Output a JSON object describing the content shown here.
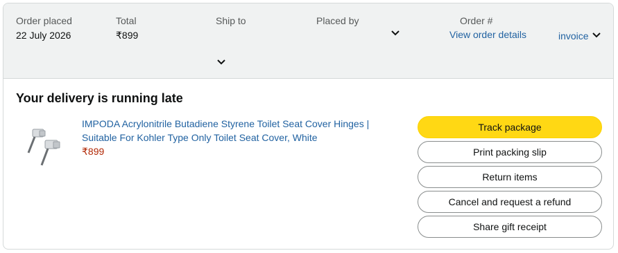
{
  "order": {
    "placed_label": "Order placed",
    "placed_value": "22 July 2026",
    "total_label": "Total",
    "total_value": "₹899",
    "ship_to_label": "Ship to",
    "placed_by_label": "Placed by",
    "order_number_label": "Order #",
    "view_details_link": "View order details",
    "invoice_link": "invoice"
  },
  "delivery": {
    "status_headline": "Your delivery is running late"
  },
  "item": {
    "title": "IMPODA Acrylonitrile Butadiene Styrene Toilet Seat Cover Hinges | Suitable For Kohler Type Only Toilet Seat Cover, White",
    "price": "₹899",
    "image_icon": "toilet-seat-hinge-product-image"
  },
  "actions": {
    "track": "Track package",
    "print": "Print packing slip",
    "return": "Return items",
    "cancel": "Cancel and request a refund",
    "gift": "Share gift receipt"
  },
  "colors": {
    "header_bg": "#f0f2f2",
    "link": "#2162a1",
    "price": "#b12704",
    "primary_button": "#ffd814"
  }
}
